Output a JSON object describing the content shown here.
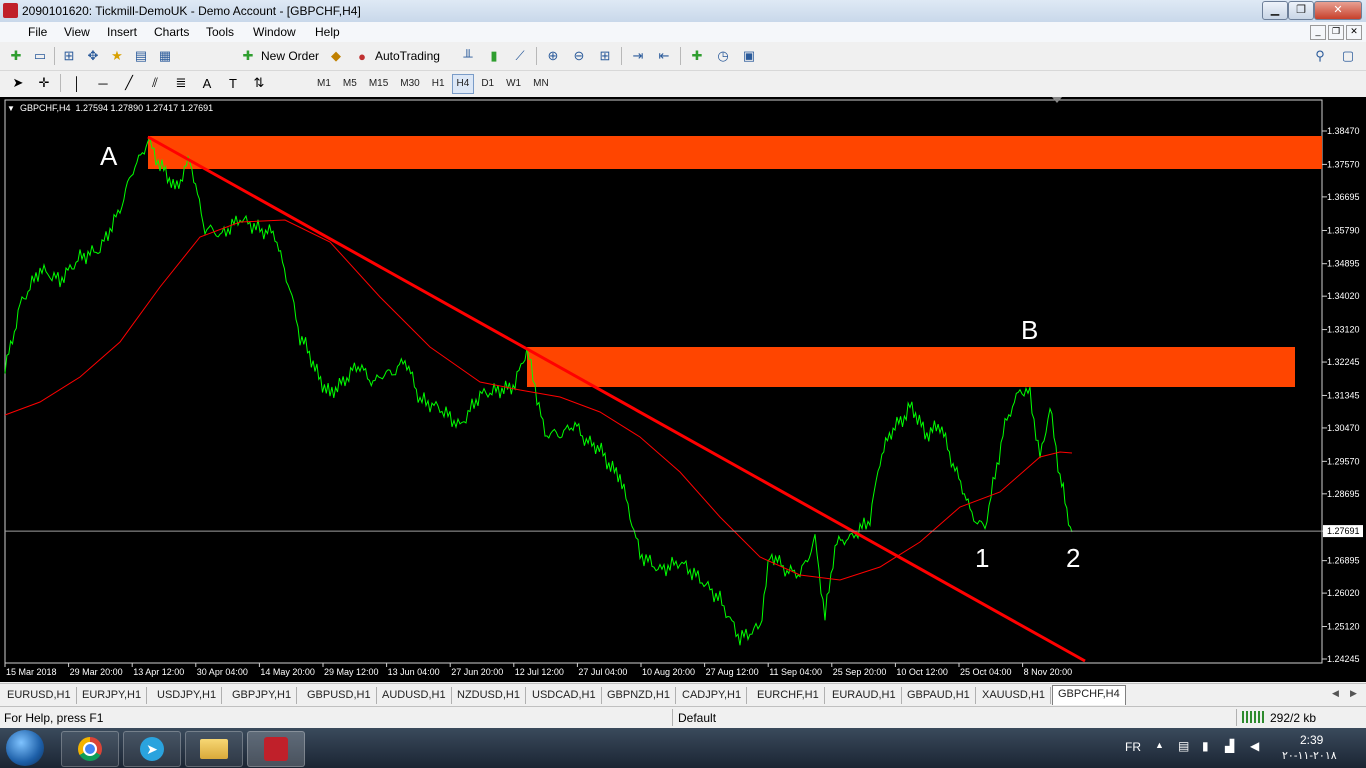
{
  "window": {
    "title": "2090101620: Tickmill-DemoUK - Demo Account - [GBPCHF,H4]",
    "minimize": "▁",
    "maximize": "❐",
    "close": "✕"
  },
  "menu": {
    "items": [
      "File",
      "View",
      "Insert",
      "Charts",
      "Tools",
      "Window",
      "Help"
    ]
  },
  "toolbar": {
    "new_order": "New Order",
    "auto_trading": "AutoTrading"
  },
  "timeframes": [
    "M1",
    "M5",
    "M15",
    "M30",
    "H1",
    "H4",
    "D1",
    "W1",
    "MN"
  ],
  "active_timeframe": "H4",
  "chart": {
    "header": "GBPCHF,H4  1.27594 1.27890 1.27417 1.27691",
    "current_price": "1.27691",
    "price_labels": [
      "1.38470",
      "1.37570",
      "1.36695",
      "1.35790",
      "1.34895",
      "1.34020",
      "1.33120",
      "1.32245",
      "1.31345",
      "1.30470",
      "1.29570",
      "1.28695",
      "1.27691",
      "1.26895",
      "1.26020",
      "1.25120",
      "1.24245"
    ],
    "date_labels": [
      "15 Mar 2018",
      "29 Mar 20:00",
      "13 Apr 12:00",
      "30 Apr 04:00",
      "14 May 20:00",
      "29 May 12:00",
      "13 Jun 04:00",
      "27 Jun 20:00",
      "12 Jul 12:00",
      "27 Jul 04:00",
      "10 Aug 20:00",
      "27 Aug 12:00",
      "11 Sep 04:00",
      "25 Sep 20:00",
      "10 Oct 12:00",
      "25 Oct 04:00",
      "8 Nov 20:00"
    ],
    "annotations": [
      "A",
      "B",
      "1",
      "2"
    ],
    "colors": {
      "price_line": "#00ff00",
      "moving_average": "#ff0000",
      "trendline": "#ff0000",
      "zone": "#ff4500",
      "background": "#000000",
      "axis_text": "#ffffff"
    }
  },
  "tabs": [
    "EURUSD,H1",
    "EURJPY,H1",
    "USDJPY,H1",
    "GBPJPY,H1",
    "GBPUSD,H1",
    "AUDUSD,H1",
    "NZDUSD,H1",
    "USDCAD,H1",
    "GBPNZD,H1",
    "CADJPY,H1",
    "EURCHF,H1",
    "EURAUD,H1",
    "GBPAUD,H1",
    "XAUUSD,H1",
    "GBPCHF,H4"
  ],
  "active_tab": "GBPCHF,H4",
  "status": {
    "help": "For Help, press F1",
    "profile": "Default",
    "traffic": "292/2 kb"
  },
  "taskbar": {
    "lang": "FR",
    "time": "2:39",
    "date": "٢٠١٨-١١-٢٠"
  }
}
